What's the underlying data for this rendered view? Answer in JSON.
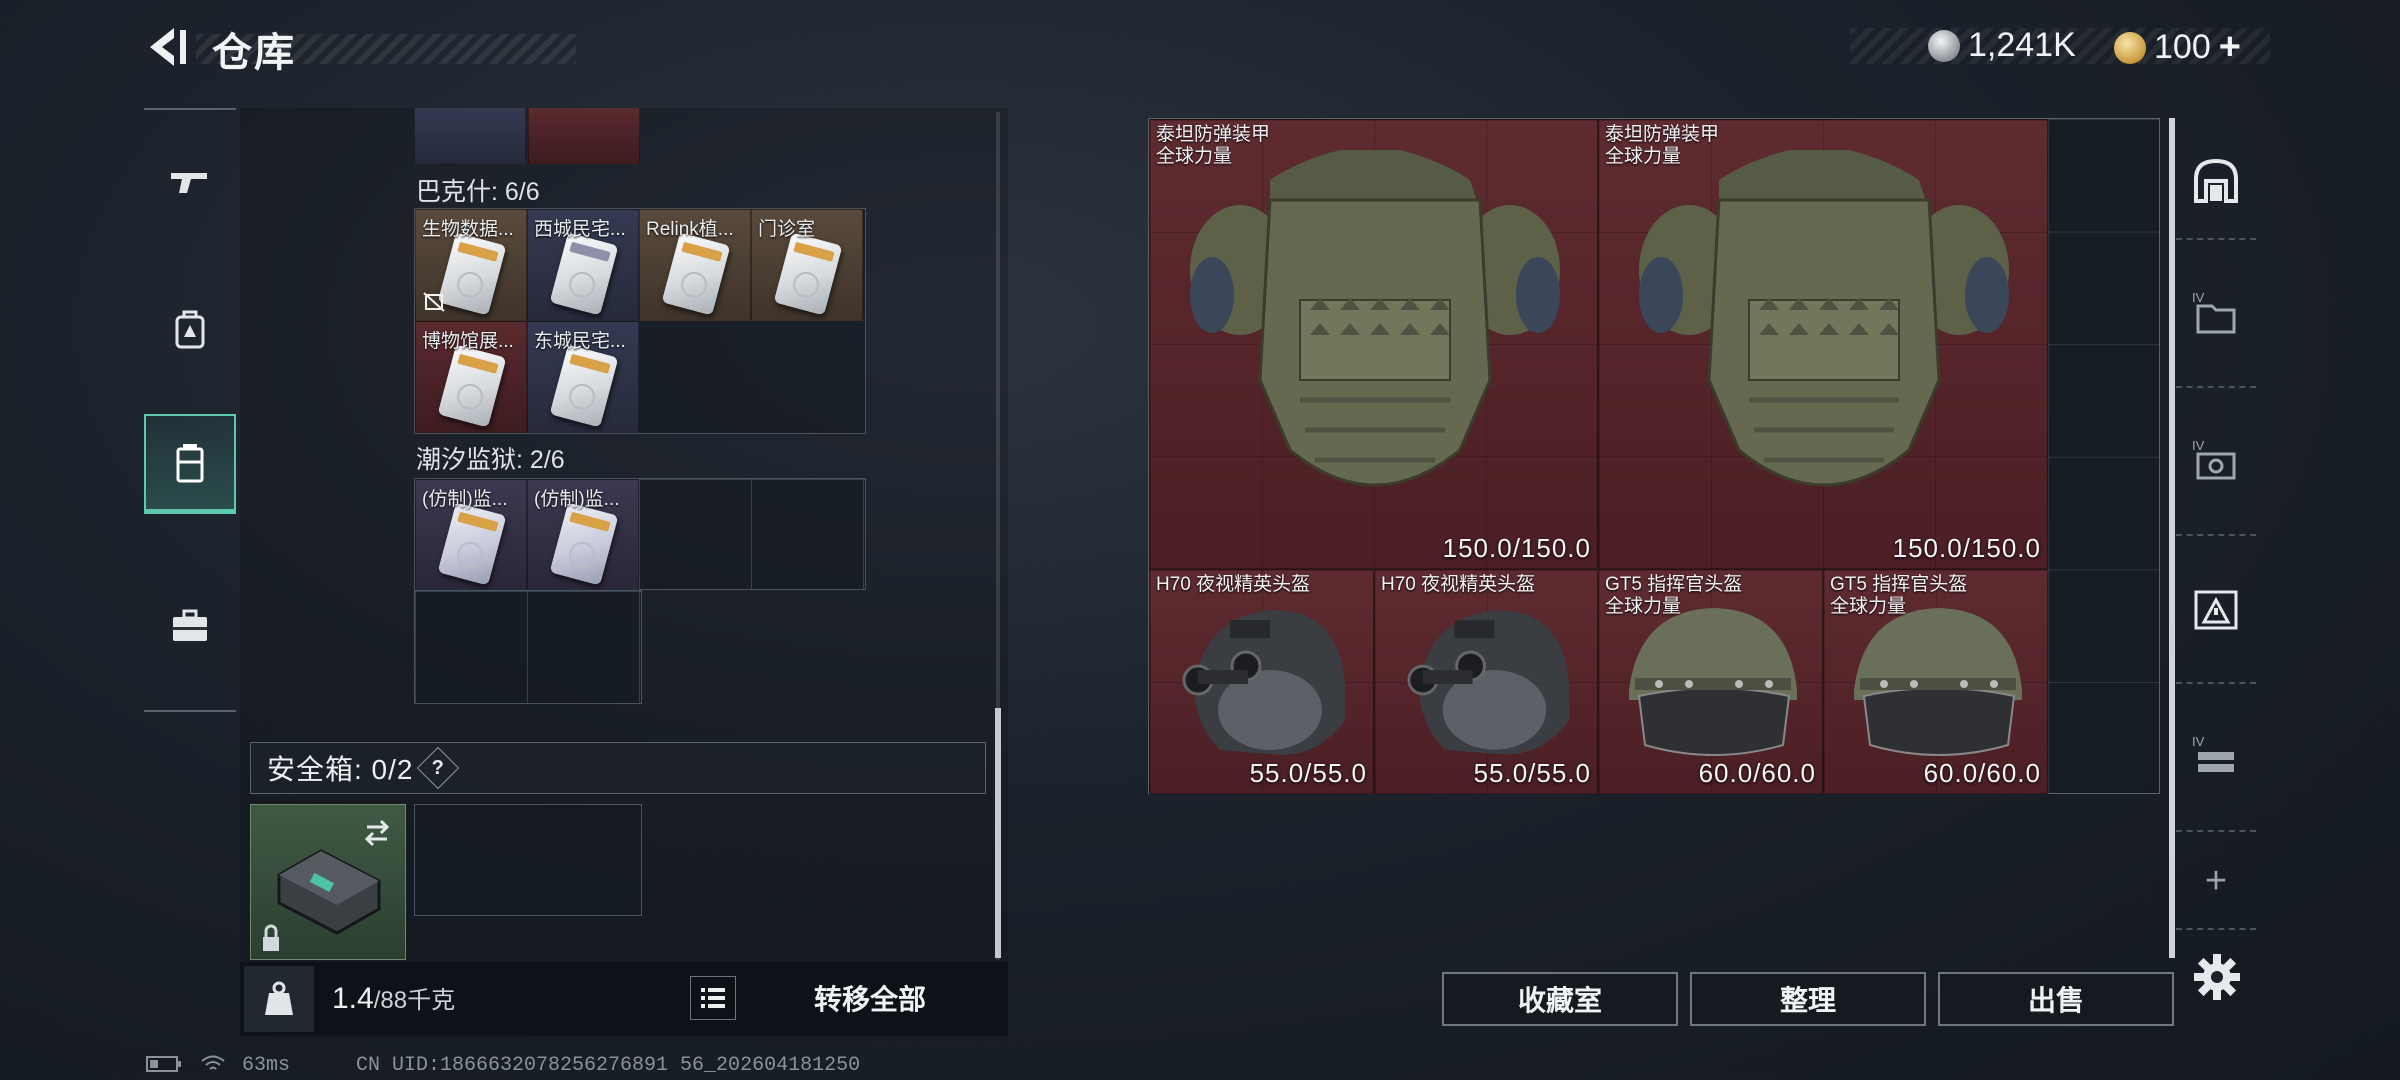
{
  "header": {
    "title": "仓库",
    "currencies": [
      {
        "icon": "silver-coin-icon",
        "value": "1,241K"
      },
      {
        "icon": "gold-coin-icon",
        "value": "100"
      }
    ],
    "add_label": "+"
  },
  "left_tabs": [
    "gun-icon",
    "backpack-icon",
    "container-icon",
    "briefcase-icon"
  ],
  "backpack": {
    "groups": [
      {
        "label": "巴克什: 6/6",
        "items": [
          "生物数据...",
          "西城民宅...",
          "Relink植...",
          "门诊室",
          "博物馆展...",
          "东城民宅..."
        ]
      },
      {
        "label": "潮汐监狱: 2/6",
        "items": [
          "(仿制)监...",
          "(仿制)监..."
        ]
      }
    ],
    "safe_box": {
      "label": "安全箱: 0/2",
      "help": "?"
    },
    "weight_current": "1.4",
    "weight_max": "/88千克",
    "transfer_label": "转移全部"
  },
  "storage": {
    "items": [
      {
        "name": "泰坦防弹装甲",
        "sub": "全球力量",
        "durability": "150.0/150.0"
      },
      {
        "name": "泰坦防弹装甲",
        "sub": "全球力量",
        "durability": "150.0/150.0"
      },
      {
        "name": "H70 夜视精英头盔",
        "sub": "",
        "durability": "55.0/55.0"
      },
      {
        "name": "H70 夜视精英头盔",
        "sub": "",
        "durability": "55.0/55.0"
      },
      {
        "name": "GT5 指挥官头盔",
        "sub": "全球力量",
        "durability": "60.0/60.0"
      },
      {
        "name": "GT5 指挥官头盔",
        "sub": "全球力量",
        "durability": "60.0/60.0"
      }
    ],
    "buttons": {
      "collection": "收藏室",
      "organize": "整理",
      "sell": "出售"
    }
  },
  "right_tabs": [
    "home-storage-icon",
    "tier4-folder-icon",
    "tier4-gear-icon",
    "warning-box-icon",
    "tier4-rack-icon"
  ],
  "status_bar": {
    "ping": "63ms",
    "uid": "CN UID:1866632078256276891 56_202604181250"
  }
}
